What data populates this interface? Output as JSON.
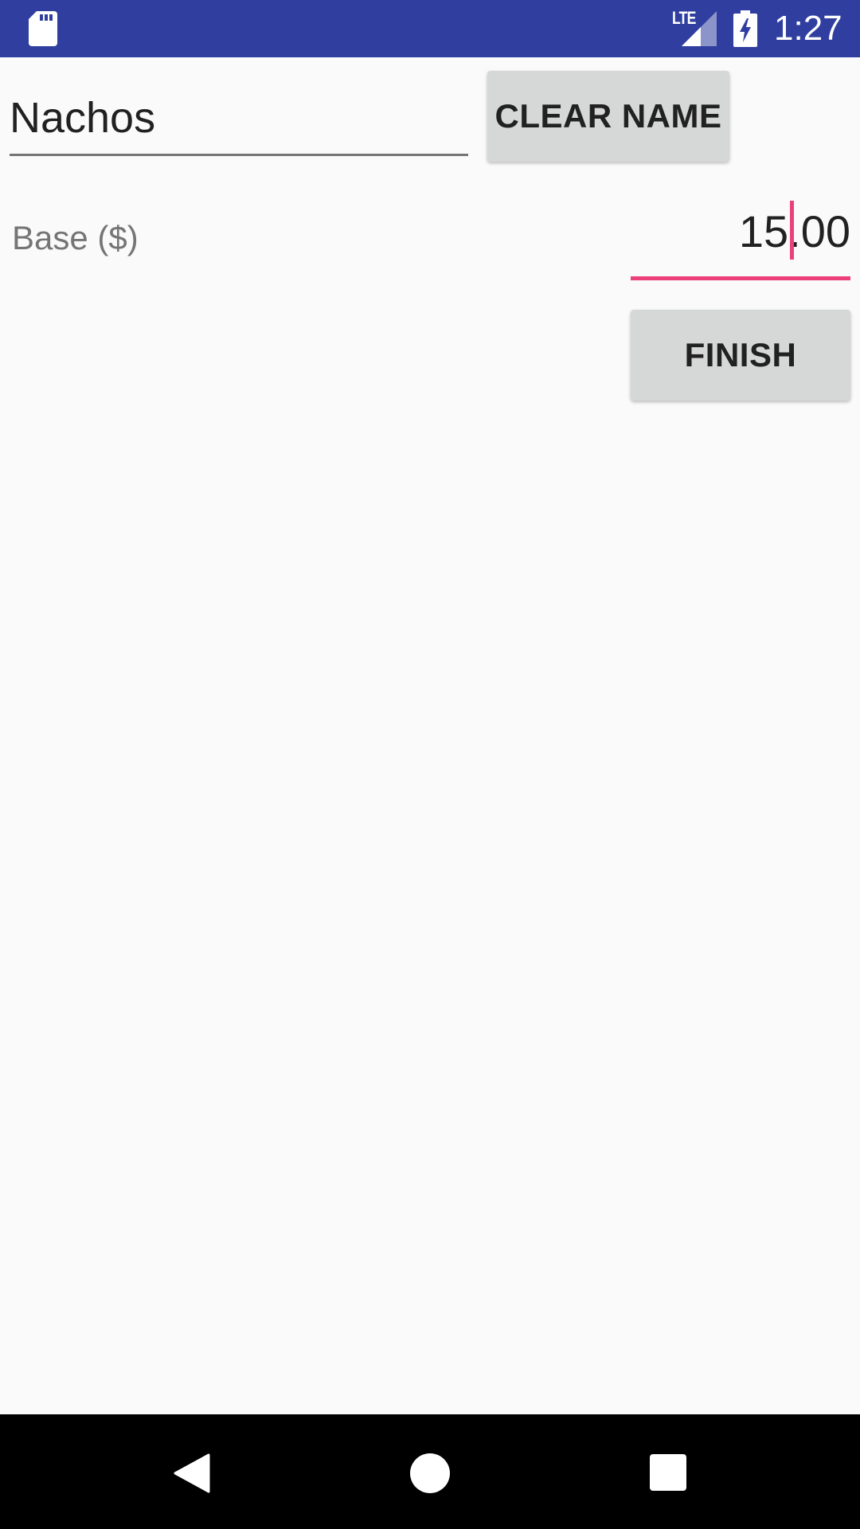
{
  "status_bar": {
    "time": "1:27",
    "network_label": "LTE",
    "icons": [
      "sd-card-icon",
      "signal-icon",
      "battery-charging-icon"
    ],
    "background": "#303f9f"
  },
  "form": {
    "name_value": "Nachos",
    "clear_name_label": "CLEAR NAME",
    "base_label": "Base ($)",
    "base_value": "15.00",
    "finish_label": "FINISH"
  },
  "nav_bar": {
    "icons": [
      "back-icon",
      "home-icon",
      "recents-icon"
    ]
  },
  "colors": {
    "accent": "#ec407a",
    "primary_dark": "#303f9f",
    "button_bg": "#d6d7d7",
    "background": "#fafafa"
  }
}
